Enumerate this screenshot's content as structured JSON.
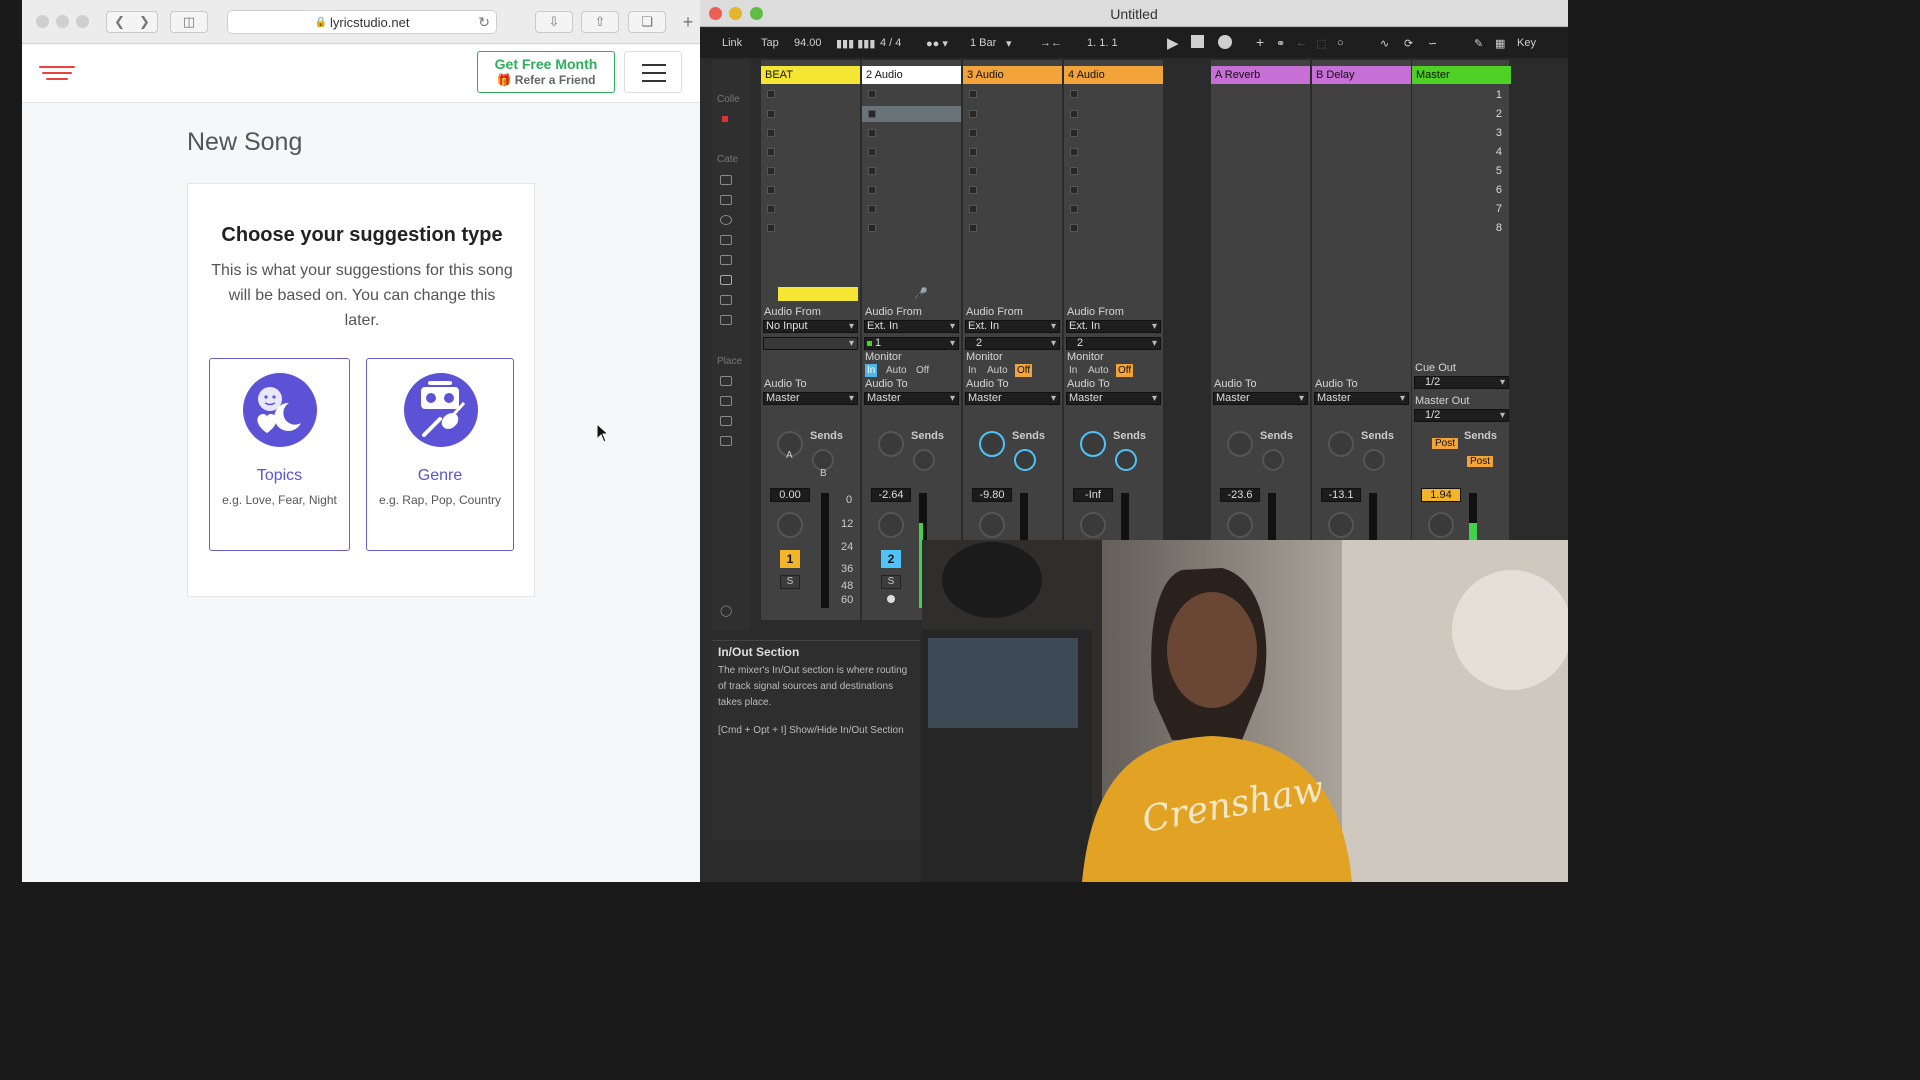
{
  "browser": {
    "url": "lyricstudio.net",
    "header": {
      "cta_line1": "Get Free Month",
      "cta_line2": "Refer a Friend"
    },
    "page_title": "New Song",
    "card": {
      "title": "Choose your suggestion type",
      "description": "This is what your suggestions for this song will be based on. You can change this later.",
      "options": [
        {
          "name": "Topics",
          "example": "e.g. Love, Fear, Night",
          "icon": "topics-icon"
        },
        {
          "name": "Genre",
          "example": "e.g. Rap, Pop, Country",
          "icon": "genre-icon"
        }
      ]
    }
  },
  "ableton": {
    "window_title": "Untitled",
    "toolbar": {
      "link": "Link",
      "tap": "Tap",
      "tempo": "94.00",
      "time_sig": "4 / 4",
      "quantize": "1 Bar",
      "position": "1.   1.   1",
      "key": "Key"
    },
    "browser_labels": [
      "Colle",
      "Cate",
      "Place"
    ],
    "tracks": [
      {
        "name": "BEAT",
        "color": "#f5e633",
        "audio_from": "No Input",
        "channel": "",
        "audio_to": "Master",
        "volume": "0.00",
        "number": "1",
        "num_color": "#f2b429"
      },
      {
        "name": "2 Audio",
        "color": "#ffffff",
        "audio_from": "Ext. In",
        "channel": "1",
        "audio_to": "Master",
        "volume": "-2.64",
        "number": "2",
        "num_color": "#4fc3f7"
      },
      {
        "name": "3 Audio",
        "color": "#f2a33a",
        "audio_from": "Ext. In",
        "channel": "2",
        "audio_to": "Master",
        "volume": "-9.80"
      },
      {
        "name": "4 Audio",
        "color": "#f2a33a",
        "audio_from": "Ext. In",
        "channel": "2",
        "audio_to": "Master",
        "volume": "-Inf"
      }
    ],
    "returns": [
      {
        "name": "A Reverb",
        "color": "#c66fd4",
        "audio_to": "Master",
        "volume": "-23.6"
      },
      {
        "name": "B Delay",
        "color": "#c66fd4",
        "audio_to": "Master",
        "volume": "-13.1"
      }
    ],
    "master": {
      "name": "Master",
      "color": "#4fd024",
      "cue_out": "1/2",
      "master_out": "1/2",
      "volume": "1.94",
      "post": "Post"
    },
    "labels": {
      "audio_from": "Audio From",
      "audio_to": "Audio To",
      "monitor": "Monitor",
      "mon_in": "In",
      "mon_auto": "Auto",
      "mon_off": "Off",
      "sends": "Sends",
      "send_a": "A",
      "send_b": "B",
      "solo": "S",
      "cue_out": "Cue Out",
      "master_out": "Master Out"
    },
    "scale": [
      "0",
      "12",
      "24",
      "36",
      "48",
      "60"
    ],
    "scenes": [
      "1",
      "2",
      "3",
      "4",
      "5",
      "6",
      "7",
      "8"
    ],
    "info": {
      "title": "In/Out Section",
      "body": "The mixer's In/Out section is where routing of track signal sources and destinations takes place.",
      "shortcut": "[Cmd + Opt + I] Show/Hide In/Out Section"
    }
  }
}
